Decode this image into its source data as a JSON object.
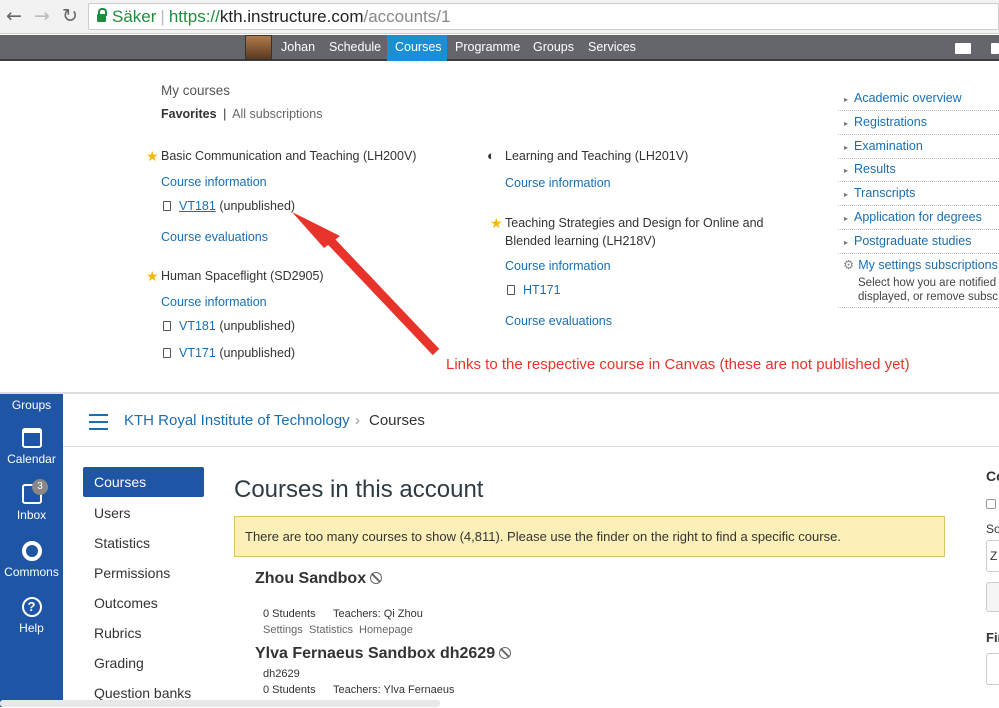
{
  "browser": {
    "back_glyph": "←",
    "forward_glyph": "→",
    "reload_glyph": "↻",
    "secure_label": "Säker",
    "url_scheme": "https://",
    "url_host": "kth.instructure.com",
    "url_path": "/accounts/1"
  },
  "kth_menu": {
    "user": "Johan",
    "items": [
      "Schedule",
      "Courses",
      "Programme",
      "Groups",
      "Services"
    ],
    "active": "Courses"
  },
  "kth_page": {
    "heading": "My courses",
    "filter_active": "Favorites",
    "filter_sep": "|",
    "filter_other": "All subscriptions",
    "course1": {
      "title": "Basic Communication and Teaching (LH200V)",
      "info": "Course information",
      "round": "VT181",
      "status": "(unpublished)",
      "eval": "Course evaluations"
    },
    "course2": {
      "title": "Human Spaceflight (SD2905)",
      "info": "Course information",
      "round1": "VT181",
      "status1": "(unpublished)",
      "round2": "VT171",
      "status2": "(unpublished)"
    },
    "course3": {
      "title": "Learning and Teaching (LH201V)",
      "info": "Course information"
    },
    "course4": {
      "title_line1": "Teaching Strategies and Design for Online and",
      "title_line2": "Blended learning (LH218V)",
      "info": "Course information",
      "round": "HT171",
      "eval": "Course evaluations"
    },
    "right_links": [
      "Academic overview",
      "Registrations",
      "Examination",
      "Results",
      "Transcripts",
      "Application for degrees",
      "Postgraduate studies"
    ],
    "settings_link": "My settings subscriptions",
    "settings_desc1": "Select how you are notified",
    "settings_desc2": "displayed, or remove subsc"
  },
  "annotation": "Links to the respective course in Canvas (these are not published yet)",
  "canvas": {
    "global_nav": [
      {
        "label": "Groups",
        "icon": "groups-icon"
      },
      {
        "label": "Calendar",
        "icon": "calendar-icon"
      },
      {
        "label": "Inbox",
        "icon": "inbox-icon"
      },
      {
        "label": "Commons",
        "icon": "commons-icon"
      },
      {
        "label": "Help",
        "icon": "help-icon"
      }
    ],
    "inbox_badge": "3",
    "help_glyph": "?",
    "crumb_root": "KTH Royal Institute of Technology",
    "crumb_sep": "›",
    "crumb_current": "Courses",
    "side_nav": [
      "Courses",
      "Users",
      "Statistics",
      "Permissions",
      "Outcomes",
      "Rubrics",
      "Grading",
      "Question banks"
    ],
    "page_title": "Courses in this account",
    "warning": "There are too many courses to show (4,811). Please use the finder on the right to find a specific course.",
    "courses": [
      {
        "name": "Zhou Sandbox",
        "students": "0 Students",
        "teachers": "Teachers: Qi Zhou",
        "links": [
          "Settings",
          "Statistics",
          "Homepage"
        ]
      },
      {
        "name": "Ylva Fernaeus Sandbox dh2629",
        "code": "dh2629",
        "students": "0 Students",
        "teachers": "Teachers: Ylva Fernaeus"
      }
    ],
    "right_panel": {
      "label1": "Co",
      "label2": "So",
      "input_value": "Z",
      "label3": "Fin"
    }
  },
  "colors": {
    "kth_menu_bg": "#65656c",
    "active_tab": "#1a8fd6",
    "canvas_nav": "#1f55a5",
    "annotation": "#e8332a",
    "star": "#f5b800"
  }
}
